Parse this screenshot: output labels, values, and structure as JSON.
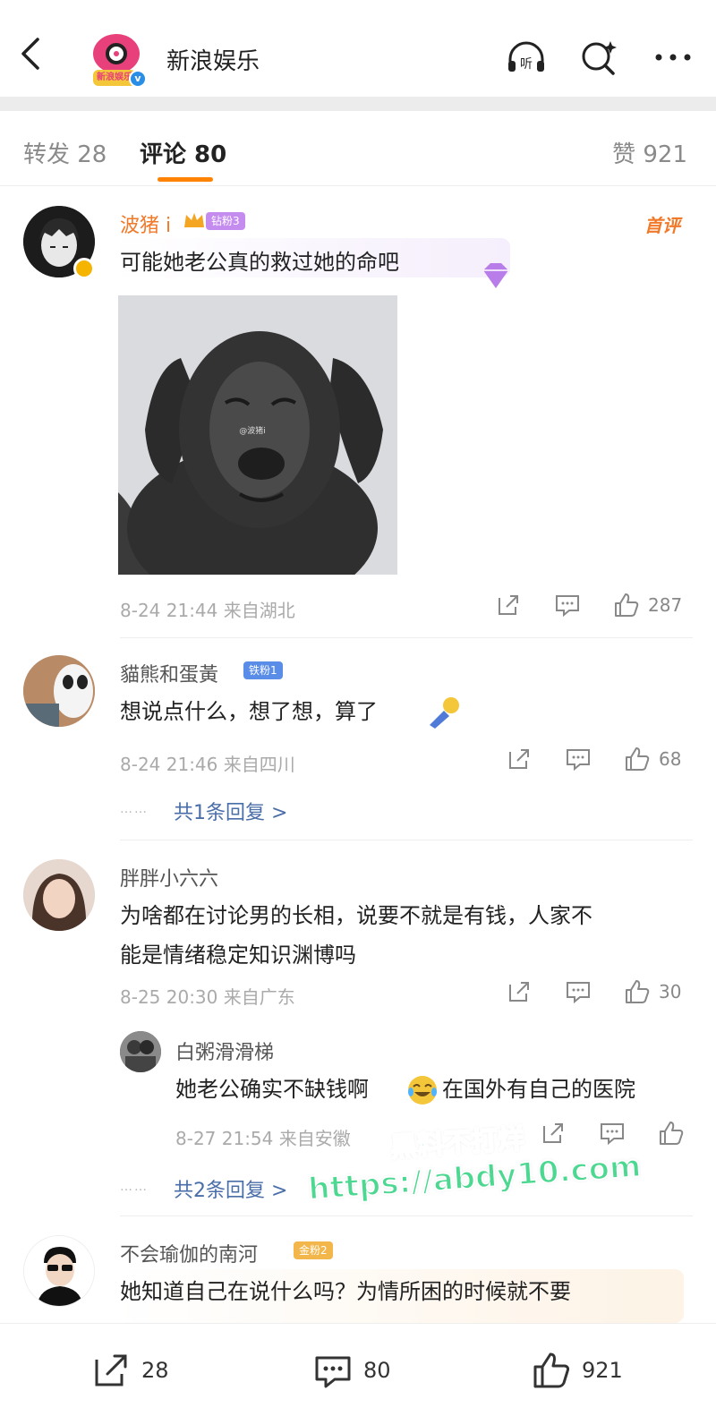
{
  "header": {
    "account_name": "新浪娱乐",
    "logo_wordmark": "新浪娱乐",
    "icons": [
      "back-icon",
      "listen-icon",
      "search-sparkle-icon",
      "more-icon"
    ],
    "listen_label": "听"
  },
  "tabs": {
    "repost": "转发 28",
    "comment": "评论 80",
    "like": "赞 921",
    "accent": "#ff8200"
  },
  "comments": [
    {
      "user": "波猪 i",
      "badge": "钻粉3",
      "tag": "首评",
      "text": "可能她老公真的救过她的命吧",
      "meta": "8-24 21:44 来自湖北",
      "likes": "287",
      "image_watermark": "@波猪i"
    },
    {
      "user": "貓熊和蛋黃",
      "badge": "铁粉1",
      "text": "想说点什么，想了想，算了",
      "meta": "8-24 21:46 来自四川",
      "likes": "68",
      "replies": "共1条回复 >"
    },
    {
      "user": "胖胖小六六",
      "text_line1": "为啥都在讨论男的长相，说要不就是有钱，人家不",
      "text_line2": "能是情绪稳定知识渊博吗",
      "meta": "8-25 20:30 来自广东",
      "likes": "30",
      "reply": {
        "user": "白粥滑滑梯",
        "text_a": "她老公确实不缺钱啊",
        "text_b": "在国外有自己的医院",
        "meta": "8-27 21:54 来自安徽"
      },
      "replies": "共2条回复 >"
    },
    {
      "user": "不会瑜伽的南河",
      "badge": "金粉2",
      "text": "她知道自己在说什么吗？为情所困的时候就不要"
    }
  ],
  "leader": "……",
  "watermark": {
    "line1": "黑料不打烊",
    "line2": "https://abdy10.com"
  },
  "bottom": {
    "repost_count": "28",
    "comment_count": "80",
    "like_count": "921"
  }
}
